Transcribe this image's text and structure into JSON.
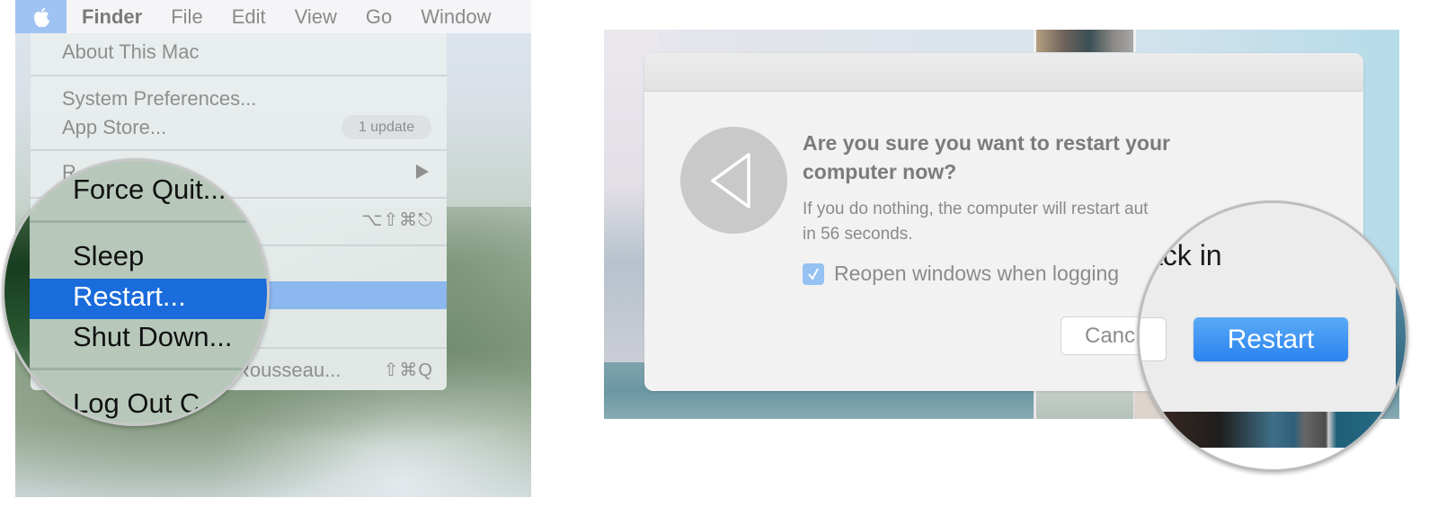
{
  "left": {
    "menubar": {
      "apple_icon": "apple-logo",
      "items": [
        "Finder",
        "File",
        "Edit",
        "View",
        "Go",
        "Window"
      ]
    },
    "apple_menu": {
      "about": "About This Mac",
      "system_preferences": "System Preferences...",
      "app_store": "App Store...",
      "app_store_badge": "1 update",
      "recent_items_partial": "R",
      "force_quit_shortcut": "⌥⇧⌘⎋",
      "log_out_partial": "Rousseau...",
      "log_out_shortcut": "⇧⌘Q",
      "highlighted_item": "Restart..."
    },
    "magnifier": {
      "items": [
        "Force Quit...",
        "Sleep",
        "Restart...",
        "Shut Down...",
        "Log Out C"
      ],
      "selected": "Restart..."
    }
  },
  "right": {
    "dialog": {
      "icon": "restart-triangle",
      "title": "Are you sure you want to restart your computer now?",
      "body_visible": "If you do nothing, the computer will restart aut",
      "body_line2": "in 56 seconds.",
      "countdown_seconds": 56,
      "checkbox_label_visible": "Reopen windows when logging",
      "checkbox_checked": true,
      "cancel_label_visible": "Canc"
    },
    "magnifier": {
      "text_fragment": "ack in",
      "restart_button": "Restart"
    },
    "colors": {
      "accent_blue": "#2a83ef",
      "menu_highlight": "#1a6bdb"
    }
  }
}
